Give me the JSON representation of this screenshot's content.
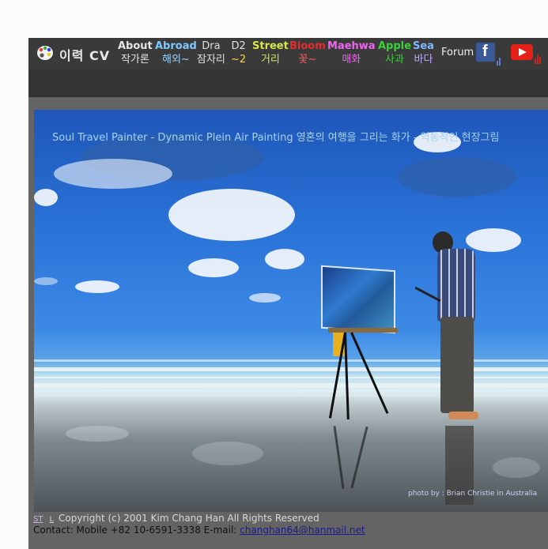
{
  "nav": {
    "cv_label": "이력 CV",
    "items": [
      {
        "en": "About",
        "ko": "작가론",
        "en_color": "#e6e6e6",
        "ko_color": "#e6e6e6"
      },
      {
        "en": "Abroad",
        "ko": "해외~",
        "en_color": "#7fc8ff",
        "ko_color": "#9fd4ff"
      },
      {
        "en": "Dra",
        "ko": "잠자리",
        "en_color": "#e0e0e0",
        "ko_color": "#e0e0e0"
      },
      {
        "en": "D2",
        "ko": "~2",
        "en_color": "#e0e0e0",
        "ko_color": "#ffd24a"
      },
      {
        "en": "Street",
        "ko": "거리",
        "en_color": "#d6e84a",
        "ko_color": "#d6e84a"
      },
      {
        "en": "Bloom",
        "ko": "꽃~",
        "en_color": "#e82a2a",
        "ko_color": "#ff5a5a"
      },
      {
        "en": "Maehwa",
        "ko": "매화",
        "en_color": "#ee66ee",
        "ko_color": "#ee66ee"
      },
      {
        "en": "Apple",
        "ko": "사과",
        "en_color": "#3ad13a",
        "ko_color": "#3ad13a"
      },
      {
        "en": "Sea",
        "ko": "바다",
        "en_color": "#7fb8ff",
        "ko_color": "#bfa8ff"
      }
    ],
    "forum_label": "Forum",
    "facebook_icon": "facebook-icon",
    "youtube_icon": "youtube-icon"
  },
  "photo": {
    "title": "Soul Travel Painter - Dynamic Plein Air Painting 영혼의 여행을 그리는 화가 - 역동적인 현장그림",
    "credit": "photo by : Brian Christie in Australia"
  },
  "footer": {
    "st_link": "ST",
    "l_link": "L",
    "copyright": "Copyright (c) 2001 Kim Chang Han  All Rights Reserved",
    "contact_prefix": "Contact: Mobile +82 10-6591-3338    E-mail: ",
    "email": "changhan64@hanmail.net"
  }
}
